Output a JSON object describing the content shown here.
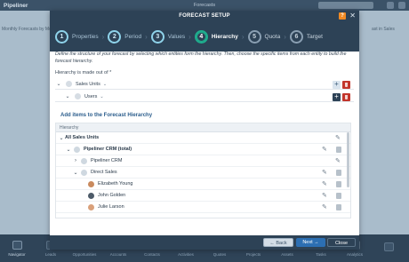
{
  "app": {
    "logo": "Pipeliner",
    "title": "Forecasts",
    "left_snippet": "Monthly Forecasts by Mo",
    "right_snippet": "ast in Sales"
  },
  "modal": {
    "title": "FORECAST SETUP",
    "help_label": "?",
    "close_label": "✕",
    "steps": [
      {
        "number": "1",
        "label": "Properties",
        "state": "done"
      },
      {
        "number": "2",
        "label": "Period",
        "state": "done"
      },
      {
        "number": "3",
        "label": "Values",
        "state": "done"
      },
      {
        "number": "4",
        "label": "Hierarchy",
        "state": "active"
      },
      {
        "number": "5",
        "label": "Quota",
        "state": "future"
      },
      {
        "number": "6",
        "label": "Target",
        "state": "future"
      }
    ],
    "description": "Define the structure of your forecast by selecting which entities form the hierarchy. Then, choose the specific items from each entity to build the forecast hierarchy.",
    "hierarchy_label": "Hierarchy is made out of *",
    "hierarchy_levels": [
      {
        "label": "Sales Units"
      },
      {
        "label": "Users"
      }
    ],
    "section_title": "Add items to the Forecast Hierarchy",
    "table_header": "Hierarchy",
    "tree": [
      {
        "label": "All Sales Units"
      },
      {
        "label": "Pipeliner CRM (total)"
      },
      {
        "label": "Pipeliner CRM"
      },
      {
        "label": "Direct Sales"
      },
      {
        "label": "Elizabeth Young"
      },
      {
        "label": "John Golden"
      },
      {
        "label": "Julie Larson"
      }
    ],
    "footer": {
      "back_label": "← Back",
      "next_label": "Next →",
      "close_label": "Close"
    }
  },
  "bottom_nav": [
    {
      "label": "Navigator"
    },
    {
      "label": "Leads"
    },
    {
      "label": "Opportunities"
    },
    {
      "label": "Accounts"
    },
    {
      "label": "Contacts"
    },
    {
      "label": "Activities"
    },
    {
      "label": "Quotes"
    },
    {
      "label": "Projects"
    },
    {
      "label": "Assets"
    },
    {
      "label": "Tasks"
    },
    {
      "label": "Analytics"
    },
    {
      "label": ""
    }
  ],
  "colors": {
    "header": "#2d4256",
    "active_step": "#1fae8e",
    "done_step": "#8fd3ea",
    "help": "#f08a24",
    "delete": "#c2352b",
    "next": "#2c6fb3"
  }
}
